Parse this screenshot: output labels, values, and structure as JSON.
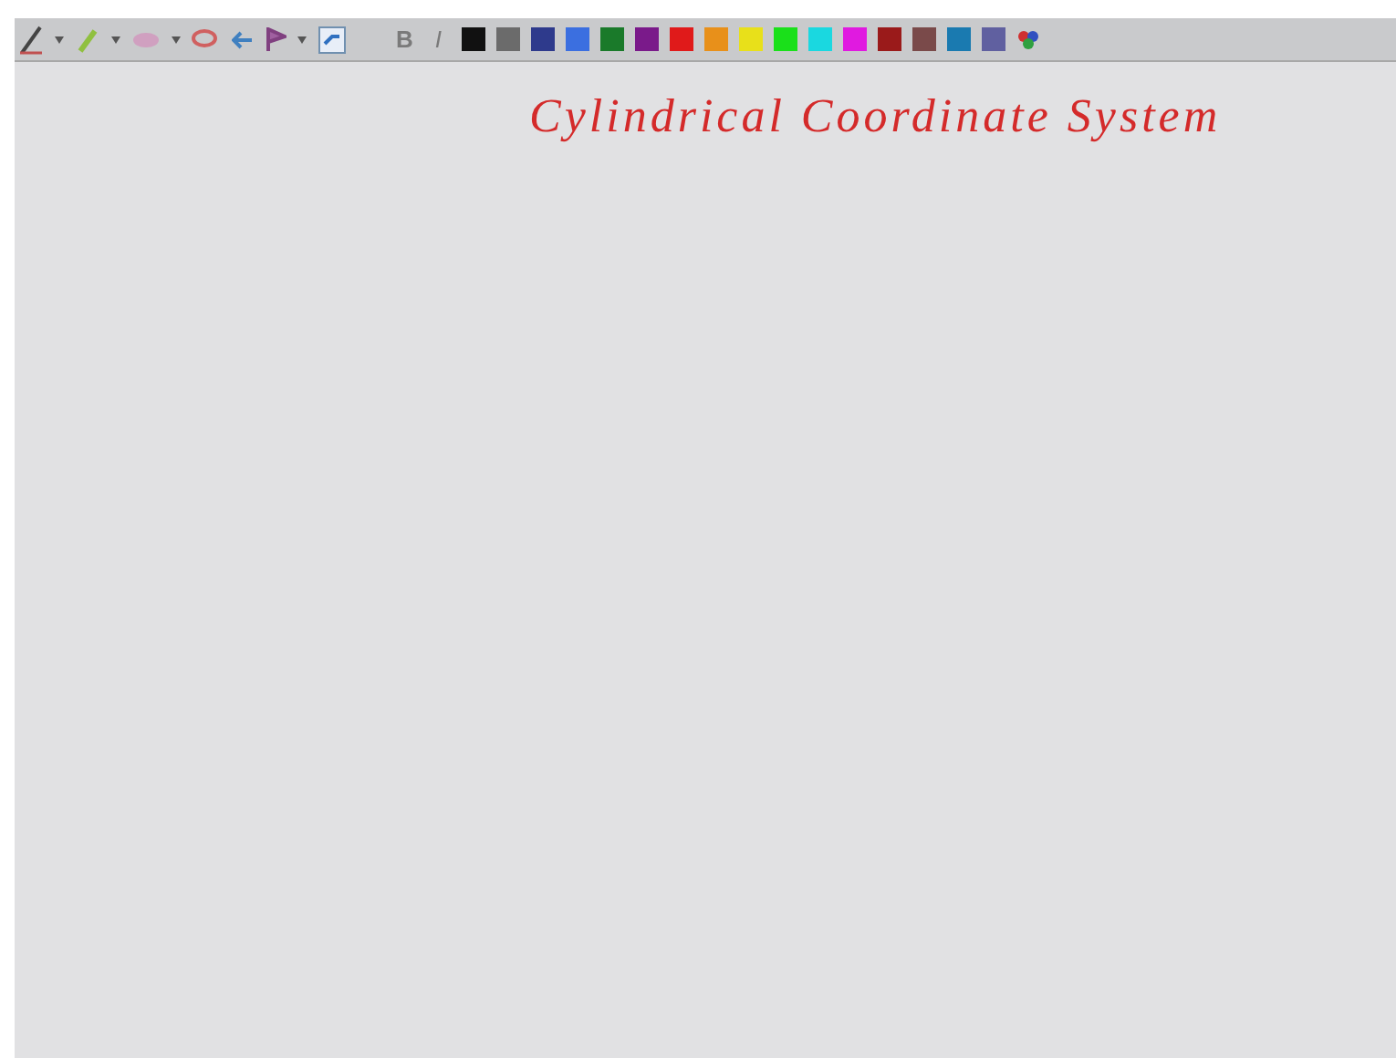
{
  "toolbar": {
    "format_buttons": [
      {
        "label": "B",
        "kind": "bold",
        "disabled": true
      },
      {
        "label": "I",
        "kind": "italic",
        "disabled": true
      }
    ],
    "swatches": [
      {
        "color": "#111111"
      },
      {
        "color": "#6b6b6b"
      },
      {
        "color": "#2e3a8c"
      },
      {
        "color": "#3b6fe0"
      },
      {
        "color": "#1a7a2a"
      },
      {
        "color": "#7a1a8a"
      },
      {
        "color": "#e01a1a"
      },
      {
        "color": "#e8901a"
      },
      {
        "color": "#e8e01a"
      },
      {
        "color": "#1ae01a"
      },
      {
        "color": "#1ad8e0"
      },
      {
        "color": "#e01ae0"
      },
      {
        "color": "#9a1a1a"
      },
      {
        "color": "#7a4a4a"
      },
      {
        "color": "#1a7ab0"
      },
      {
        "color": "#6060a0"
      }
    ]
  },
  "page": {
    "heading": "Cylindrical Coordinate System"
  }
}
